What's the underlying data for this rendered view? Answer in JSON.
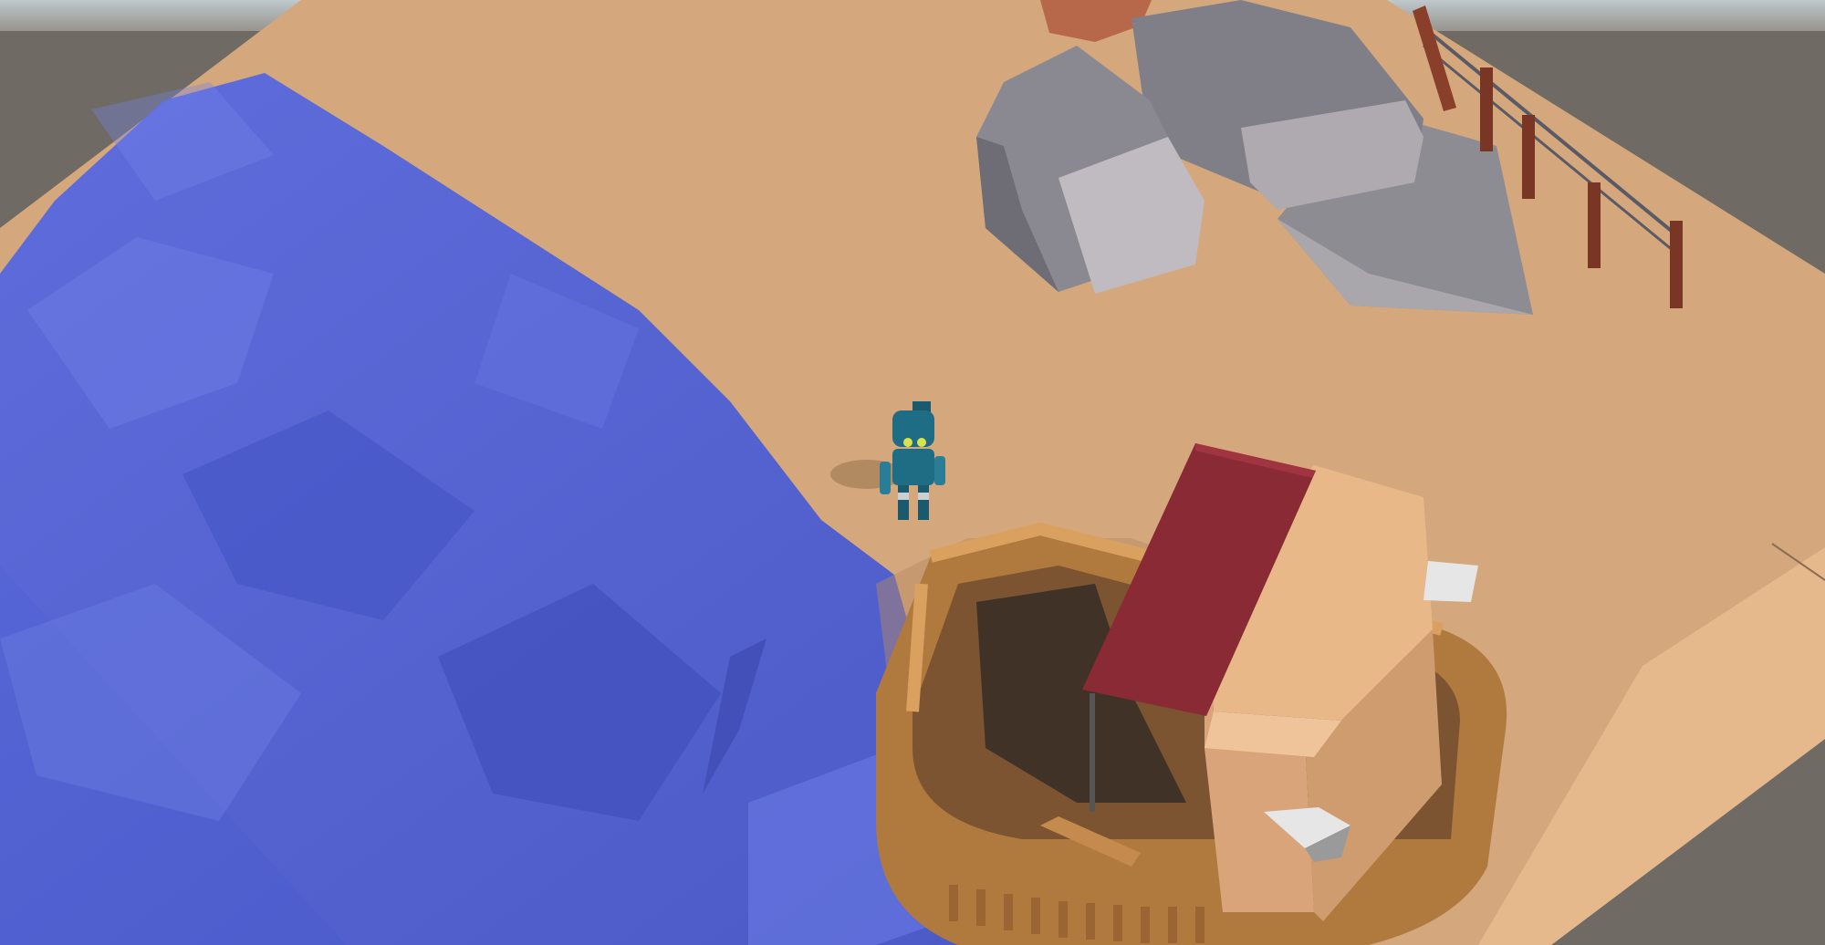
{
  "scene": {
    "colors": {
      "sky": "#cfd6d8",
      "void": "#6f6a63",
      "sand": "#d4a77c",
      "sand_edge": "#e6b98c",
      "water": "#4e5fd2",
      "water_light": "#6e7fe6",
      "rock_light": "#b9b5ba",
      "rock_mid": "#8e8c93",
      "rock_dark": "#6e6c74",
      "fence": "#8a3f2a",
      "boat_wood": "#b07a3e",
      "boat_wood_light": "#d9a060",
      "cabin": "#e8b888",
      "roof": "#8a2a35",
      "robot": "#1f6d84"
    },
    "objects": [
      {
        "name": "sand-ground",
        "icon": "terrain"
      },
      {
        "name": "water-river",
        "icon": "water"
      },
      {
        "name": "rock-cluster",
        "icon": "rock"
      },
      {
        "name": "wooden-fence",
        "icon": "fence"
      },
      {
        "name": "robot-character",
        "icon": "robot"
      },
      {
        "name": "wooden-boat",
        "icon": "boat"
      },
      {
        "name": "boat-cabin",
        "icon": "cabin"
      },
      {
        "name": "red-roof",
        "icon": "roof"
      }
    ]
  }
}
